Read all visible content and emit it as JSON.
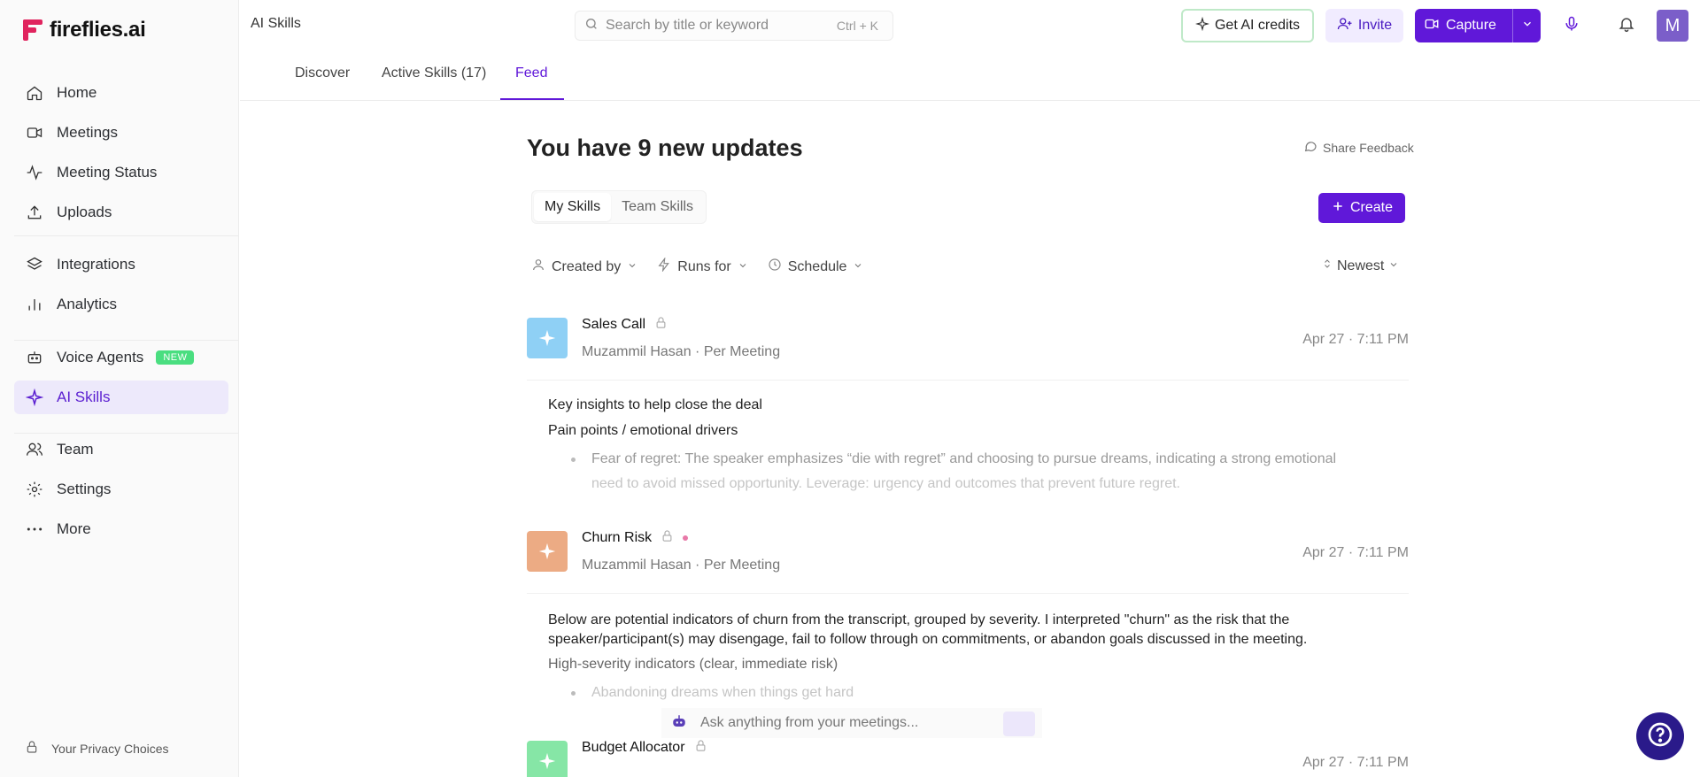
{
  "app": {
    "name": "fireflies.ai"
  },
  "sidebar": {
    "groups": [
      [
        {
          "id": "home",
          "label": "Home",
          "icon": "home-icon"
        },
        {
          "id": "meetings",
          "label": "Meetings",
          "icon": "video-icon"
        },
        {
          "id": "meeting-status",
          "label": "Meeting Status",
          "icon": "activity-icon"
        },
        {
          "id": "uploads",
          "label": "Uploads",
          "icon": "upload-icon"
        }
      ],
      [
        {
          "id": "integrations",
          "label": "Integrations",
          "icon": "layers-icon"
        },
        {
          "id": "analytics",
          "label": "Analytics",
          "icon": "bar-chart-icon"
        }
      ],
      [
        {
          "id": "voice-agents",
          "label": "Voice Agents",
          "icon": "robot-icon",
          "badge": "NEW"
        },
        {
          "id": "ai-skills",
          "label": "AI Skills",
          "icon": "sparkle-icon",
          "active": true
        }
      ],
      [
        {
          "id": "team",
          "label": "Team",
          "icon": "users-icon"
        },
        {
          "id": "settings",
          "label": "Settings",
          "icon": "gear-icon"
        },
        {
          "id": "more",
          "label": "More",
          "icon": "more-icon"
        }
      ]
    ],
    "privacy": "Your Privacy Choices"
  },
  "topbar": {
    "page_label": "AI Skills",
    "search_placeholder": "Search by title or keyword",
    "search_shortcut": "Ctrl + K",
    "credits_label": "Get AI credits",
    "invite_label": "Invite",
    "capture_label": "Capture",
    "avatar_initial": "M"
  },
  "tabs": {
    "discover": "Discover",
    "active": "Active Skills",
    "active_count": "(17)",
    "feed": "Feed"
  },
  "main": {
    "heading": "You have 9 new updates",
    "feedback_label": "Share Feedback",
    "subtabs": {
      "my": "My Skills",
      "team": "Team Skills"
    },
    "create_label": "Create",
    "filters": {
      "created_by": "Created by",
      "runs_for": "Runs for",
      "schedule": "Schedule"
    },
    "sort_label": "Newest",
    "cards": [
      {
        "title": "Sales Call",
        "author": "Muzammil Hasan",
        "frequency": "Per Meeting",
        "date": "Apr 27",
        "time": "7:11 PM",
        "color": "#8fd0f5",
        "lines": [
          "Key insights to help close the deal",
          "Pain points / emotional drivers"
        ],
        "bullet": "Fear of regret: The speaker emphasizes “die with regret” and choosing to pursue dreams, indicating a strong emotional",
        "bullet2": "need to avoid missed opportunity. Leverage: urgency and outcomes that prevent future regret."
      },
      {
        "title": "Churn Risk",
        "author": "Muzammil Hasan",
        "frequency": "Per Meeting",
        "date": "Apr 27",
        "time": "7:11 PM",
        "color": "#ecab84",
        "lines": [
          "Below are potential indicators of churn from the transcript, grouped by severity. I interpreted \"churn\" as the risk that the",
          "speaker/participant(s) may disengage, fail to follow through on commitments, or abandon goals discussed in the meeting."
        ],
        "subline": "High-severity indicators (clear, immediate risk)",
        "bullet": "Abandoning dreams when things get hard"
      },
      {
        "title": "Budget Allocator",
        "date": "Apr 27",
        "time": "7:11 PM",
        "color": "#86e6a6"
      }
    ],
    "ask_placeholder": "Ask anything from your meetings..."
  },
  "colors": {
    "brand": "#6018d9",
    "active_bg": "#ede9fb",
    "logo": "#e0245e"
  }
}
